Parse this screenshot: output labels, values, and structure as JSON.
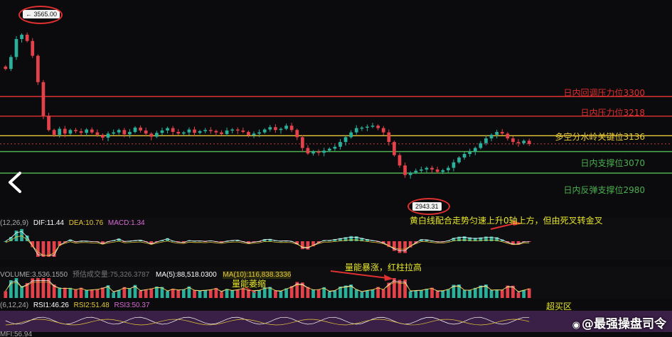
{
  "chart_data": {
    "type": "candlestick",
    "title": "",
    "ylim": [
      2920,
      3600
    ],
    "highs_marked": {
      "high": "3565.00",
      "low": "2943.31"
    },
    "levels": [
      {
        "label": "日内回调压力位3300",
        "value": 3300,
        "color": "#e03030"
      },
      {
        "label": "日内压力位3218",
        "value": 3218,
        "color": "#e03030"
      },
      {
        "label": "多空分水岭关键位3136",
        "value": 3136,
        "color": "#e8c93a"
      },
      {
        "label": "日内支撑位3070",
        "value": 3070,
        "color": "#4caf50"
      },
      {
        "label": "日内反弹支撑位2980",
        "value": 2980,
        "color": "#4caf50"
      }
    ],
    "close": [
      3415,
      3465,
      3540,
      3558,
      3532,
      3470,
      3360,
      3220,
      3160,
      3140,
      3165,
      3145,
      3160,
      3155,
      3148,
      3162,
      3150,
      3140,
      3128,
      3145,
      3150,
      3160,
      3142,
      3152,
      3170,
      3158,
      3145,
      3132,
      3148,
      3158,
      3168,
      3152,
      3145,
      3150,
      3162,
      3148,
      3155,
      3160,
      3156,
      3150,
      3143,
      3158,
      3162,
      3158,
      3152,
      3138,
      3145,
      3150,
      3162,
      3172,
      3160,
      3165,
      3178,
      3160,
      3130,
      3085,
      3062,
      3070,
      3065,
      3074,
      3082,
      3090,
      3110,
      3130,
      3150,
      3168,
      3170,
      3174,
      3178,
      3168,
      3150,
      3110,
      3055,
      3012,
      2972,
      2982,
      2990,
      2995,
      3002,
      2995,
      2985,
      2992,
      3002,
      3025,
      3045,
      3060,
      3070,
      3085,
      3105,
      3125,
      3140,
      3152,
      3145,
      3125,
      3110,
      3105,
      3115,
      3102
    ],
    "macd": {
      "header": "(12,26,9)",
      "dif_label": "DIF:11.44",
      "dea_label": "DEA:10.76",
      "macd_label": "MACD:1.34"
    },
    "volume": {
      "header": "VOLUME:3,536.1550",
      "pred_label": "预估成交量:75,326.3787",
      "ma5_label": "MA(5):88,518.0300",
      "ma10_label": "MA(10):116,838.3336"
    },
    "rsi": {
      "header": "(6,12,24)",
      "rsi1_label": "RSI1:46.26",
      "rsi2_label": "RSI2:51.48",
      "rsi3_label": "RSI3:50.37"
    },
    "mfi": {
      "header": "MFI:56.94"
    }
  },
  "annotations": {
    "macd_note": "黄白线配合走势匀速上升0轴上方，但由死叉转金叉",
    "volume_note": "量能暴涨，红柱拉高",
    "shrink_note": "量能萎缩",
    "overbuy_note": "超买区"
  },
  "colors": {
    "up": "#2bb09c",
    "down": "#e3424a",
    "dif": "#ffffff",
    "dea": "#e8c93a"
  },
  "watermark": "@最强操盘司令",
  "icons": {
    "back": "chevron-left-icon",
    "watermark": "user-icon"
  }
}
